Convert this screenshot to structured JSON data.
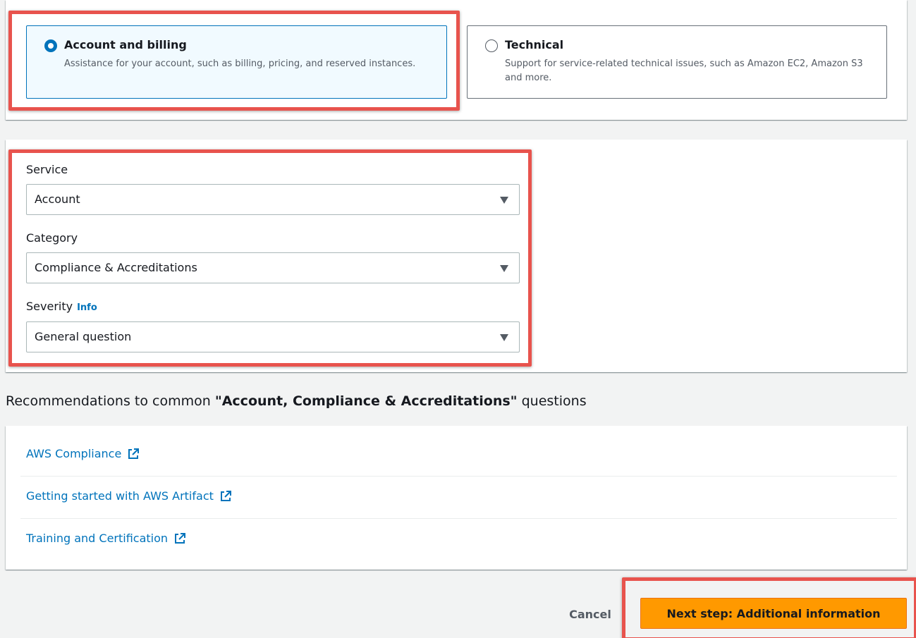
{
  "case_type": {
    "options": [
      {
        "title": "Account and billing",
        "description": "Assistance for your account, such as billing, pricing, and reserved instances.",
        "selected": true
      },
      {
        "title": "Technical",
        "description": "Support for service-related technical issues, such as Amazon EC2, Amazon S3 and more.",
        "selected": false
      }
    ]
  },
  "fields": {
    "service": {
      "label": "Service",
      "value": "Account"
    },
    "category": {
      "label": "Category",
      "value": "Compliance & Accreditations"
    },
    "severity": {
      "label": "Severity",
      "info_label": "Info",
      "value": "General question"
    }
  },
  "recommendations": {
    "heading_prefix": "Recommendations to common ",
    "heading_bold": "\"Account, Compliance & Accreditations\"",
    "heading_suffix": " questions",
    "links": [
      {
        "label": "AWS Compliance",
        "icon": "external-link-icon"
      },
      {
        "label": "Getting started with AWS Artifact",
        "icon": "external-link-icon"
      },
      {
        "label": "Training and Certification",
        "icon": "external-link-icon"
      }
    ]
  },
  "footer": {
    "cancel_label": "Cancel",
    "next_label": "Next step: Additional information"
  },
  "colors": {
    "accent_blue": "#0073bb",
    "primary_orange": "#ff9900",
    "highlight_red": "#e8534d",
    "page_background": "#f2f3f3"
  }
}
